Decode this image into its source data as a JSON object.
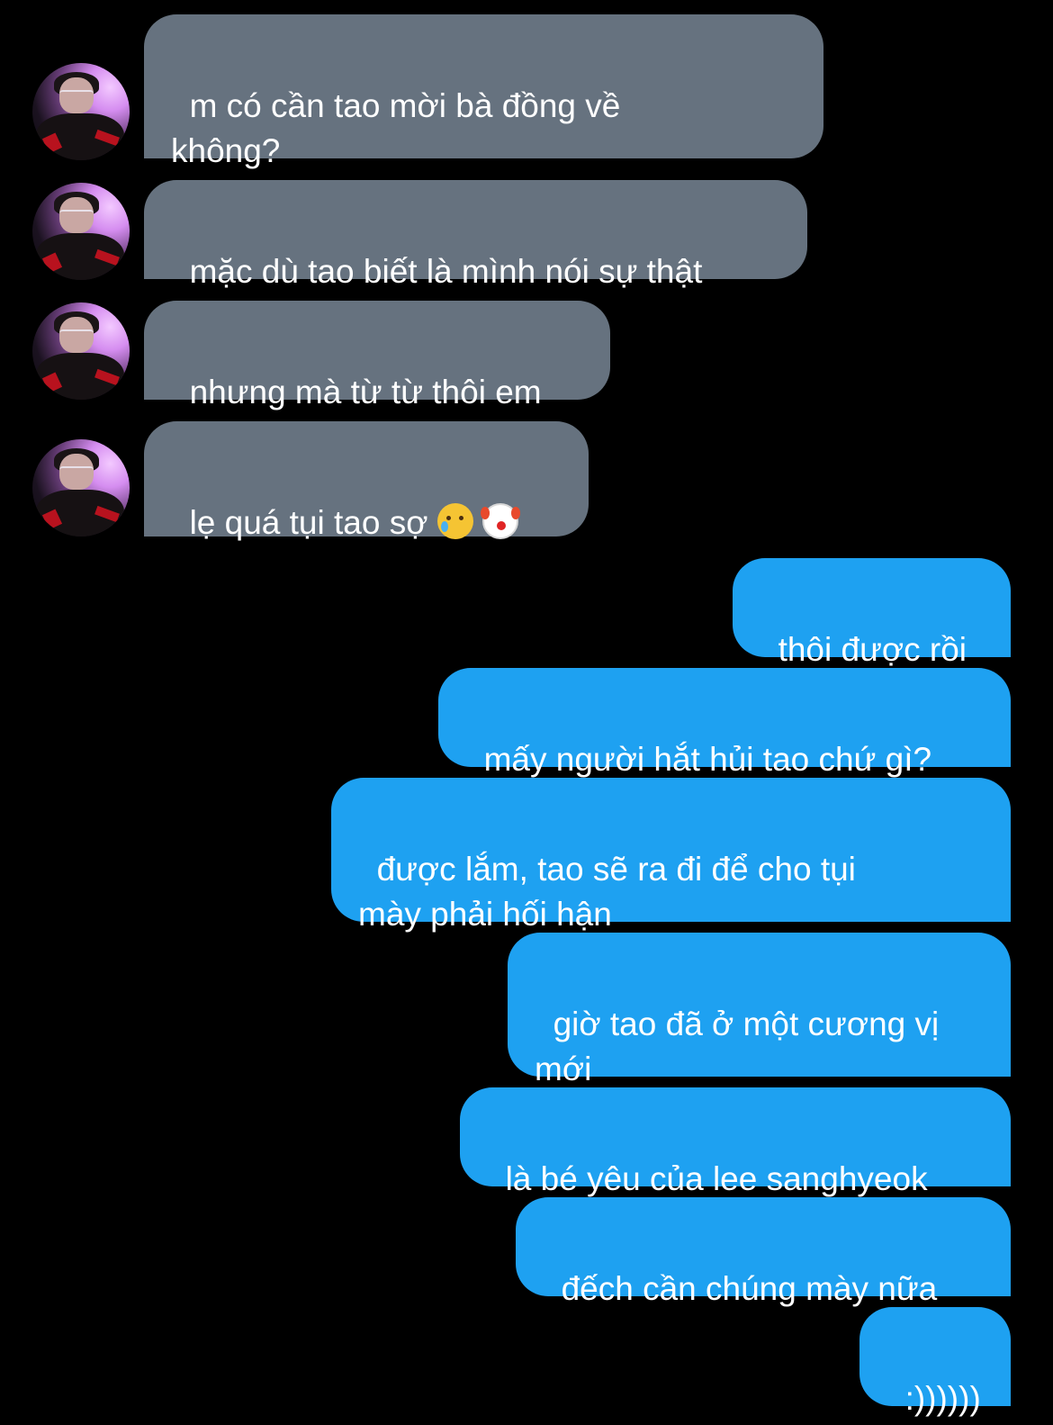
{
  "conversation": {
    "incoming": [
      {
        "text": "m có cần tao mời bà đồng về\nkhông?"
      },
      {
        "text": "mặc dù tao biết là mình nói sự thật"
      },
      {
        "text": "nhưng mà từ từ thôi em"
      },
      {
        "text": "lẹ quá tụi tao sợ",
        "emojis": [
          "crying-face",
          "clown-face"
        ]
      }
    ],
    "outgoing": [
      {
        "text": "thôi được rồi"
      },
      {
        "text": "mấy người hắt hủi tao chứ gì?"
      },
      {
        "text": "được lắm, tao sẽ ra đi để cho tụi\nmày phải hối hận"
      },
      {
        "text": "giờ tao đã ở một cương vị\nmới"
      },
      {
        "text": "là bé yêu của lee sanghyeok"
      },
      {
        "text": "đếch cần chúng mày nữa"
      },
      {
        "text": ":))))))"
      }
    ]
  },
  "colors": {
    "background": "#000000",
    "incoming_bubble": "#66727f",
    "outgoing_bubble": "#1ea1f1",
    "text": "#ffffff"
  }
}
